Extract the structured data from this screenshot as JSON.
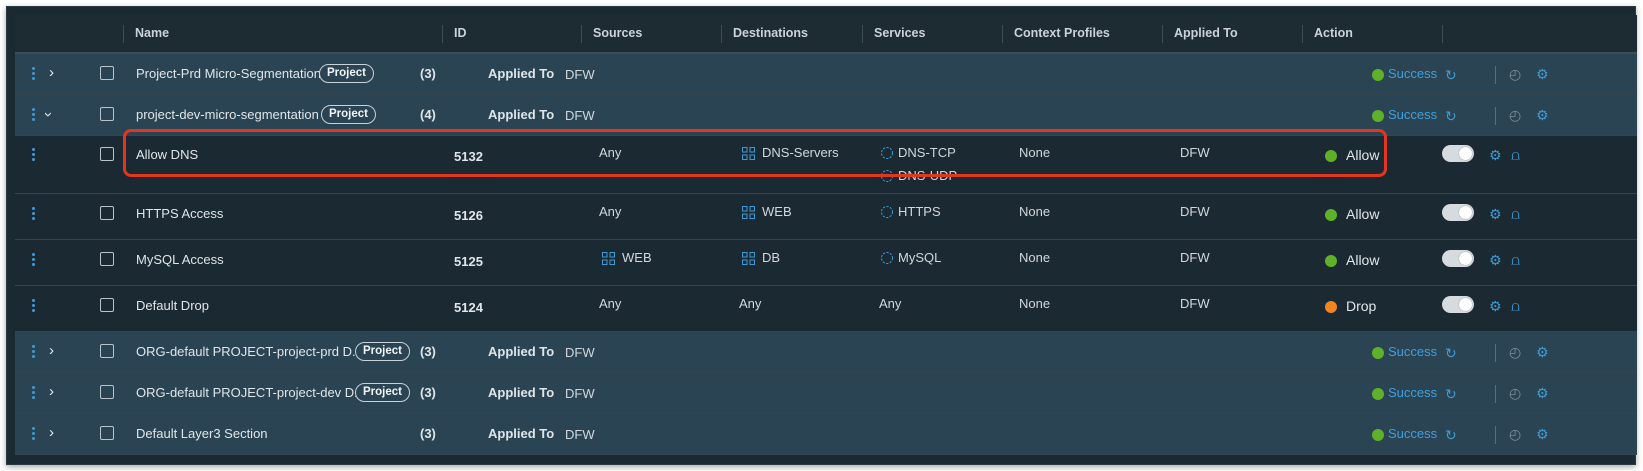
{
  "columns": [
    "Name",
    "ID",
    "Sources",
    "Destinations",
    "Services",
    "Context Profiles",
    "Applied To",
    "Action"
  ],
  "badge_label": "Project",
  "applied_to_label": "Applied To",
  "sections_top": [
    {
      "name": "Project-Prd Micro-Segmentation",
      "count": "(3)",
      "applied": "DFW",
      "status": "Success",
      "expanded": false
    },
    {
      "name": "project-dev-micro-segmentation",
      "count": "(4)",
      "applied": "DFW",
      "status": "Success",
      "expanded": true
    }
  ],
  "rules": [
    {
      "name": "Allow DNS",
      "id": "5132",
      "sources": "Any",
      "destinations": "DNS-Servers",
      "services": [
        "DNS-TCP",
        "DNS-UDP"
      ],
      "context": "None",
      "applied": "DFW",
      "action": "Allow",
      "action_color": "#5fb12a"
    },
    {
      "name": "HTTPS Access",
      "id": "5126",
      "sources": "Any",
      "destinations": "WEB",
      "services": [
        "HTTPS"
      ],
      "context": "None",
      "applied": "DFW",
      "action": "Allow",
      "action_color": "#5fb12a"
    },
    {
      "name": "MySQL Access",
      "id": "5125",
      "sources": "WEB",
      "destinations": "DB",
      "services": [
        "MySQL"
      ],
      "context": "None",
      "applied": "DFW",
      "action": "Allow",
      "action_color": "#5fb12a"
    },
    {
      "name": "Default Drop",
      "id": "5124",
      "sources": "Any",
      "destinations": "Any",
      "services": [
        "Any"
      ],
      "context": "None",
      "applied": "DFW",
      "action": "Drop",
      "action_color": "#f0861f"
    }
  ],
  "sections_bottom": [
    {
      "name": "ORG-default PROJECT-project-prd D...",
      "count": "(3)",
      "applied": "DFW",
      "status": "Success",
      "badge": true
    },
    {
      "name": "ORG-default PROJECT-project-dev D...",
      "count": "(3)",
      "applied": "DFW",
      "status": "Success",
      "badge": true
    },
    {
      "name": "Default Layer3 Section",
      "count": "(3)",
      "applied": "DFW",
      "status": "Success",
      "badge": false
    }
  ],
  "colors": {
    "accent": "#3f9bd6",
    "success": "#5fb12a",
    "drop": "#f0861f",
    "highlight": "#e2361f"
  }
}
